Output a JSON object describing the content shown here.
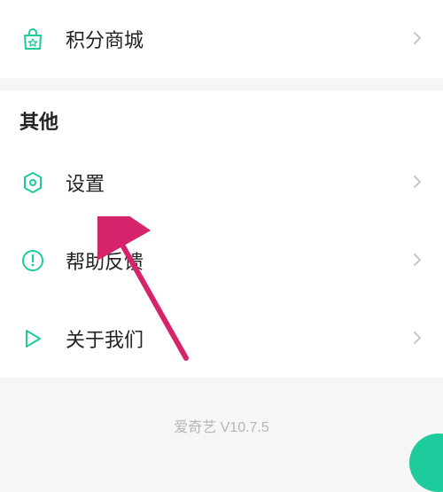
{
  "colors": {
    "accent": "#1ecb9c",
    "arrow": "#d6246c"
  },
  "top": {
    "points_mall": {
      "label": "积分商城",
      "icon": "points-mall-icon"
    }
  },
  "other": {
    "header": "其他",
    "items": [
      {
        "label": "设置",
        "icon": "settings-icon"
      },
      {
        "label": "帮助反馈",
        "icon": "help-feedback-icon"
      },
      {
        "label": "关于我们",
        "icon": "about-us-icon"
      }
    ]
  },
  "footer": {
    "version": "爱奇艺 V10.7.5"
  }
}
